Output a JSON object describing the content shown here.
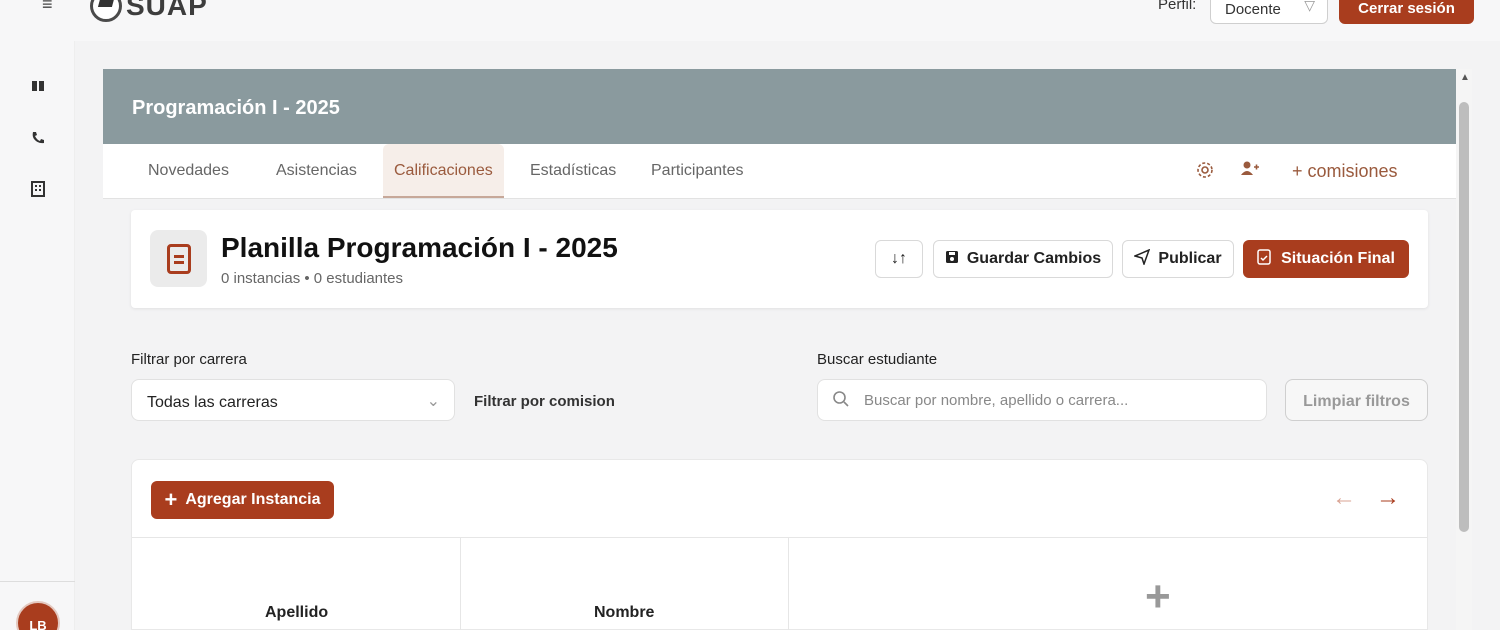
{
  "header": {
    "logo_text": "SUAP",
    "perfil_label": "Perfil:",
    "perfil_value": "Docente",
    "logout_label": "Cerrar sesión"
  },
  "sidebar": {
    "icons": [
      "book-icon",
      "phone-icon",
      "building-icon"
    ],
    "avatar_initials": "LB"
  },
  "course": {
    "title": "Programación I - 2025"
  },
  "tabs": [
    {
      "label": "Novedades",
      "active": false
    },
    {
      "label": "Asistencias",
      "active": false
    },
    {
      "label": "Calificaciones",
      "active": true
    },
    {
      "label": "Estadísticas",
      "active": false
    },
    {
      "label": "Participantes",
      "active": false
    }
  ],
  "tab_tools": {
    "comisiones_label": "+ comisiones"
  },
  "planilla": {
    "title": "Planilla Programación I - 2025",
    "subtitle": "0 instancias • 0 estudiantes",
    "save_label": "Guardar Cambios",
    "publish_label": "Publicar",
    "final_label": "Situación Final"
  },
  "filters": {
    "carrera_label": "Filtrar por carrera",
    "carrera_value": "Todas las carreras",
    "comision_label": "Filtrar por comision",
    "search_label": "Buscar estudiante",
    "search_placeholder": "Buscar por nombre, apellido o carrera...",
    "clear_label": "Limpiar filtros"
  },
  "table": {
    "add_label": "Agregar Instancia",
    "columns": [
      "Apellido",
      "Nombre"
    ]
  },
  "colors": {
    "accent": "#a93d1e",
    "header_bg": "#8a9a9e",
    "tab_active": "#9a5a3d"
  }
}
